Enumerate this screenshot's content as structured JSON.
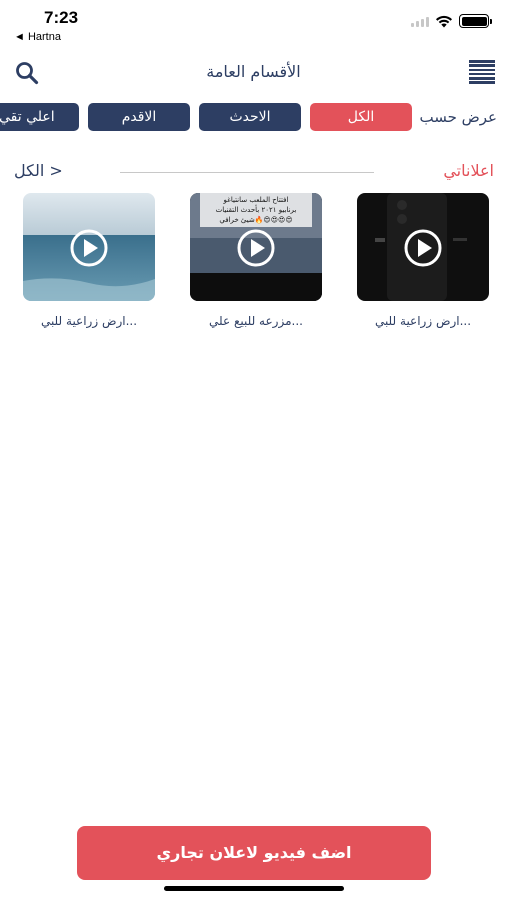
{
  "status_bar": {
    "time": "7:23",
    "back_app": "◄ Hartna"
  },
  "nav": {
    "title": "الأقسام العامة",
    "search_icon": "search-icon",
    "menu_icon": "menu-icon"
  },
  "filter": {
    "label": "عرض حسب",
    "options": [
      {
        "label": "الكل",
        "active": true
      },
      {
        "label": "الاحدث",
        "active": false
      },
      {
        "label": "الاقدم",
        "active": false
      },
      {
        "label": "اعلي تقي",
        "active": false
      }
    ]
  },
  "section": {
    "title": "اعلاناتي",
    "see_all": "الكل >"
  },
  "videos": [
    {
      "title": "ارض زراعية للبي...",
      "thumb": "dark phone"
    },
    {
      "title": "مزرعه للبيع علي...",
      "thumb": "resort overlay",
      "overlay_lines": [
        "افتتاح الملعب سانتياغو",
        "برنابيو ٢٠٢١ بأحدث التقنيات",
        "شيئ خرافي🔥😍😍😍😍"
      ]
    },
    {
      "title": "ارض زراعية للبي...",
      "thumb": "sea"
    }
  ],
  "cta": {
    "label": "اضف فيديو لاعلان تجاري"
  },
  "colors": {
    "accent": "#e3525a",
    "navy": "#2d3e63"
  }
}
